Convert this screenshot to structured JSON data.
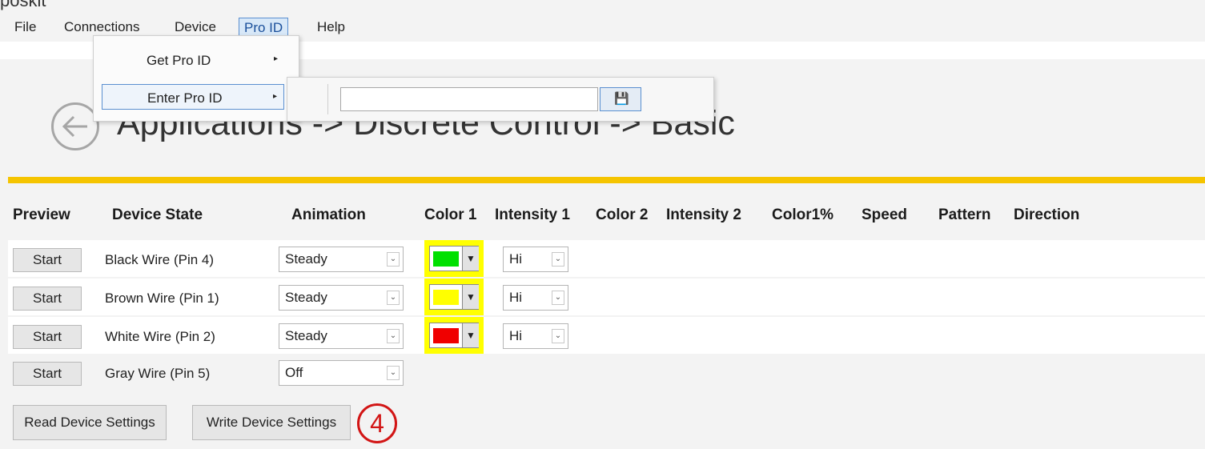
{
  "top_fragment": "poskit",
  "menubar": {
    "items": [
      "File",
      "Connections",
      "Device",
      "Pro ID",
      "Help"
    ],
    "active": "Pro ID"
  },
  "pro_id_menu": {
    "items": [
      {
        "label": "Get Pro ID",
        "arrow": "▸"
      },
      {
        "label": "Enter Pro ID",
        "arrow": "▸"
      }
    ],
    "enter_input_value": "",
    "save_icon": "💾"
  },
  "header": {
    "back_icon": "back-arrow-icon",
    "title": "Applications -> Discrete Control -> Basic",
    "accent_color": "#f5c400"
  },
  "table": {
    "columns": [
      "Preview",
      "Device State",
      "Animation",
      "Color 1",
      "Intensity 1",
      "Color 2",
      "Intensity 2",
      "Color1%",
      "Speed",
      "Pattern",
      "Direction"
    ],
    "rows": [
      {
        "preview": "Start",
        "state": "Black Wire (Pin 4)",
        "animation": "Steady",
        "color1": "#00e000",
        "intensity1": "Hi"
      },
      {
        "preview": "Start",
        "state": "Brown Wire (Pin 1)",
        "animation": "Steady",
        "color1": "#ffff00",
        "intensity1": "Hi"
      },
      {
        "preview": "Start",
        "state": "White Wire (Pin 2)",
        "animation": "Steady",
        "color1": "#f00000",
        "intensity1": "Hi"
      },
      {
        "preview": "Start",
        "state": "Gray Wire (Pin 5)",
        "animation": "Off"
      }
    ]
  },
  "footer": {
    "read_button": "Read Device Settings",
    "write_button": "Write Device Settings",
    "step_marker": "4"
  }
}
